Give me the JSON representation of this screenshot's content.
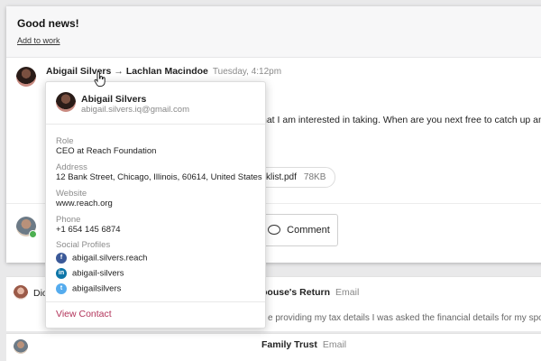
{
  "card": {
    "title": "Good news!",
    "add_to_work": "Add to work"
  },
  "message": {
    "from": "Abigail Silvers",
    "arrow": "→",
    "to": "Lachlan Macindoe",
    "time": "Tuesday, 4:12pm",
    "body_fragment": "hat I am interested in taking. When are you next free to catch up and dis",
    "attachment_name": "cklist.pdf",
    "attachment_size": "78KB",
    "comment_label": "Comment"
  },
  "rows": [
    {
      "who": "Dio",
      "subject": "pouse's Return",
      "type": "Email",
      "preview": "e providing my tax details I was asked the financial details for my spouse"
    },
    {
      "who": "",
      "subject": "Family Trust",
      "type": "Email",
      "preview": ""
    }
  ],
  "popover": {
    "name": "Abigail Silvers",
    "email": "abigail.silvers.iq@gmail.com",
    "role_label": "Role",
    "role": "CEO at Reach Foundation",
    "address_label": "Address",
    "address": "12 Bank Street, Chicago, Illinois, 60614, United States",
    "website_label": "Website",
    "website": "www.reach.org",
    "phone_label": "Phone",
    "phone": "+1 654 145 6874",
    "social_label": "Social Profiles",
    "socials": [
      {
        "icon": "facebook-icon",
        "glyph": "f",
        "handle": "abigail.silvers.reach"
      },
      {
        "icon": "linkedin-icon",
        "glyph": "in",
        "handle": "abigail-silvers"
      },
      {
        "icon": "twitter-icon",
        "glyph": "t",
        "handle": "abigailsilvers"
      }
    ],
    "view_contact": "View Contact"
  },
  "colors": {
    "accent": "#b2335a",
    "online": "#4caf50"
  }
}
